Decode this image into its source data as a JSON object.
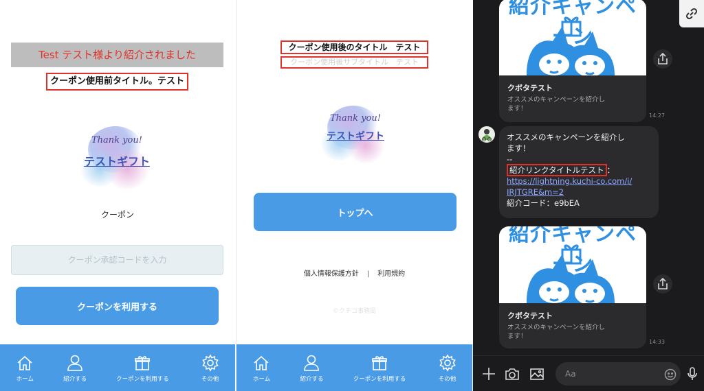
{
  "left_screen": {
    "referral_banner": "Test テスト様より紹介されました",
    "coupon_title_before": "クーポン使用前タイトル。テスト",
    "logo": {
      "script": "Thank you!",
      "text": "テストギフト"
    },
    "coupon_label": "クーポン",
    "code_input_placeholder": "クーポン承認コードを入力",
    "use_coupon_button": "クーポンを利用する"
  },
  "middle_screen": {
    "coupon_title_after": "クーポン使用後のタイトル　テスト",
    "coupon_subtitle_after": "クーポン使用後サブタイトル　テスト",
    "logo": {
      "script": "Thank you!",
      "text": "テストギフト"
    },
    "top_button": "トップへ",
    "privacy_policy": "個人情報保護方針",
    "separator": "|",
    "terms": "利用規約",
    "copyright": "©クチコ事務局"
  },
  "tabbar": {
    "home": "ホーム",
    "refer": "紹介する",
    "use_coupon": "クーポンを利用する",
    "other": "その他"
  },
  "chat": {
    "card_top": {
      "promo_title": "紹介キャンペーン",
      "title": "クボタテスト",
      "desc": "オススメのキャンペーンを紹介します！",
      "time": "14:27"
    },
    "message": {
      "line1": "オススメのキャンペーンを紹介し",
      "line2": "ます！",
      "line3": "--",
      "link_title": "紹介リンクタイトルテスト",
      "colon": "：",
      "url_line1": "https://lightning.kuchi-co.com/i/",
      "url_line2": "IRJTGRE&m=2",
      "referral_code": "紹介コード：e9bEA"
    },
    "card_bottom": {
      "promo_title": "紹介キャンペーン",
      "title": "クボタテスト",
      "desc": "オススメのキャンペーンを紹介します！",
      "time": "14:33"
    },
    "input_placeholder": "Aa"
  },
  "colors": {
    "accent_blue": "#4a9be6",
    "highlight_red": "#e0322b",
    "chat_bg": "#1b1b1d",
    "bubble_bg": "#2b2b2e",
    "link": "#8ea8ff"
  }
}
